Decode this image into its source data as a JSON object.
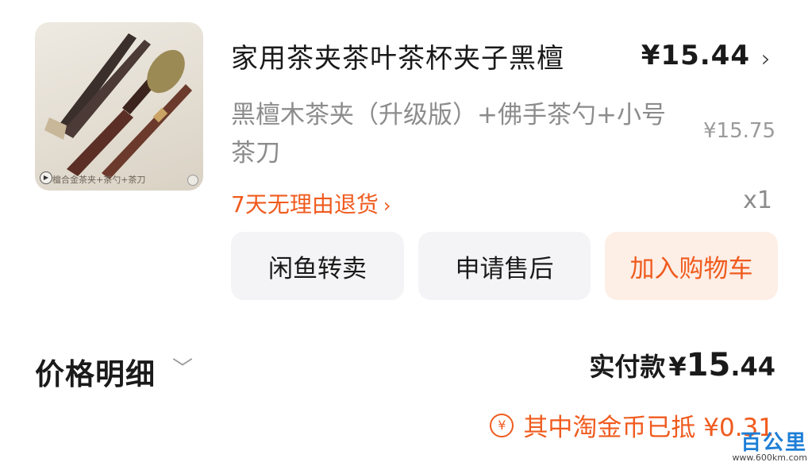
{
  "product": {
    "image_caption": "檀合金茶夹+茶勺+茶刀",
    "title": "家用茶夹茶叶茶杯夹子黑檀",
    "price": "¥15.44",
    "variant": "黑檀木茶夹（升级版）+佛手茶勺+小号茶刀",
    "original_price": "¥15.75",
    "return_policy": "7天无理由退货",
    "quantity": "x1"
  },
  "actions": {
    "resell_label": "闲鱼转卖",
    "aftersale_label": "申请售后",
    "cart_label": "加入购物车"
  },
  "summary": {
    "price_detail_label": "价格明细",
    "actual_pay_label": "实付款",
    "actual_pay_currency": "¥",
    "actual_pay_int": "15",
    "actual_pay_dec": ".44",
    "coin_text": "其中淘金币已抵 ¥0.31"
  },
  "watermark": {
    "brand": "百公里",
    "url": "www.600km.com"
  },
  "icons": {
    "play": "play-icon",
    "chevron": "chevron-right-icon",
    "coin": "yen-coin-icon"
  },
  "colors": {
    "accent": "#f05b1e",
    "button_bg": "#f4f4f6",
    "cart_bg": "#fdeee6",
    "muted_text": "#8c8c8c"
  }
}
